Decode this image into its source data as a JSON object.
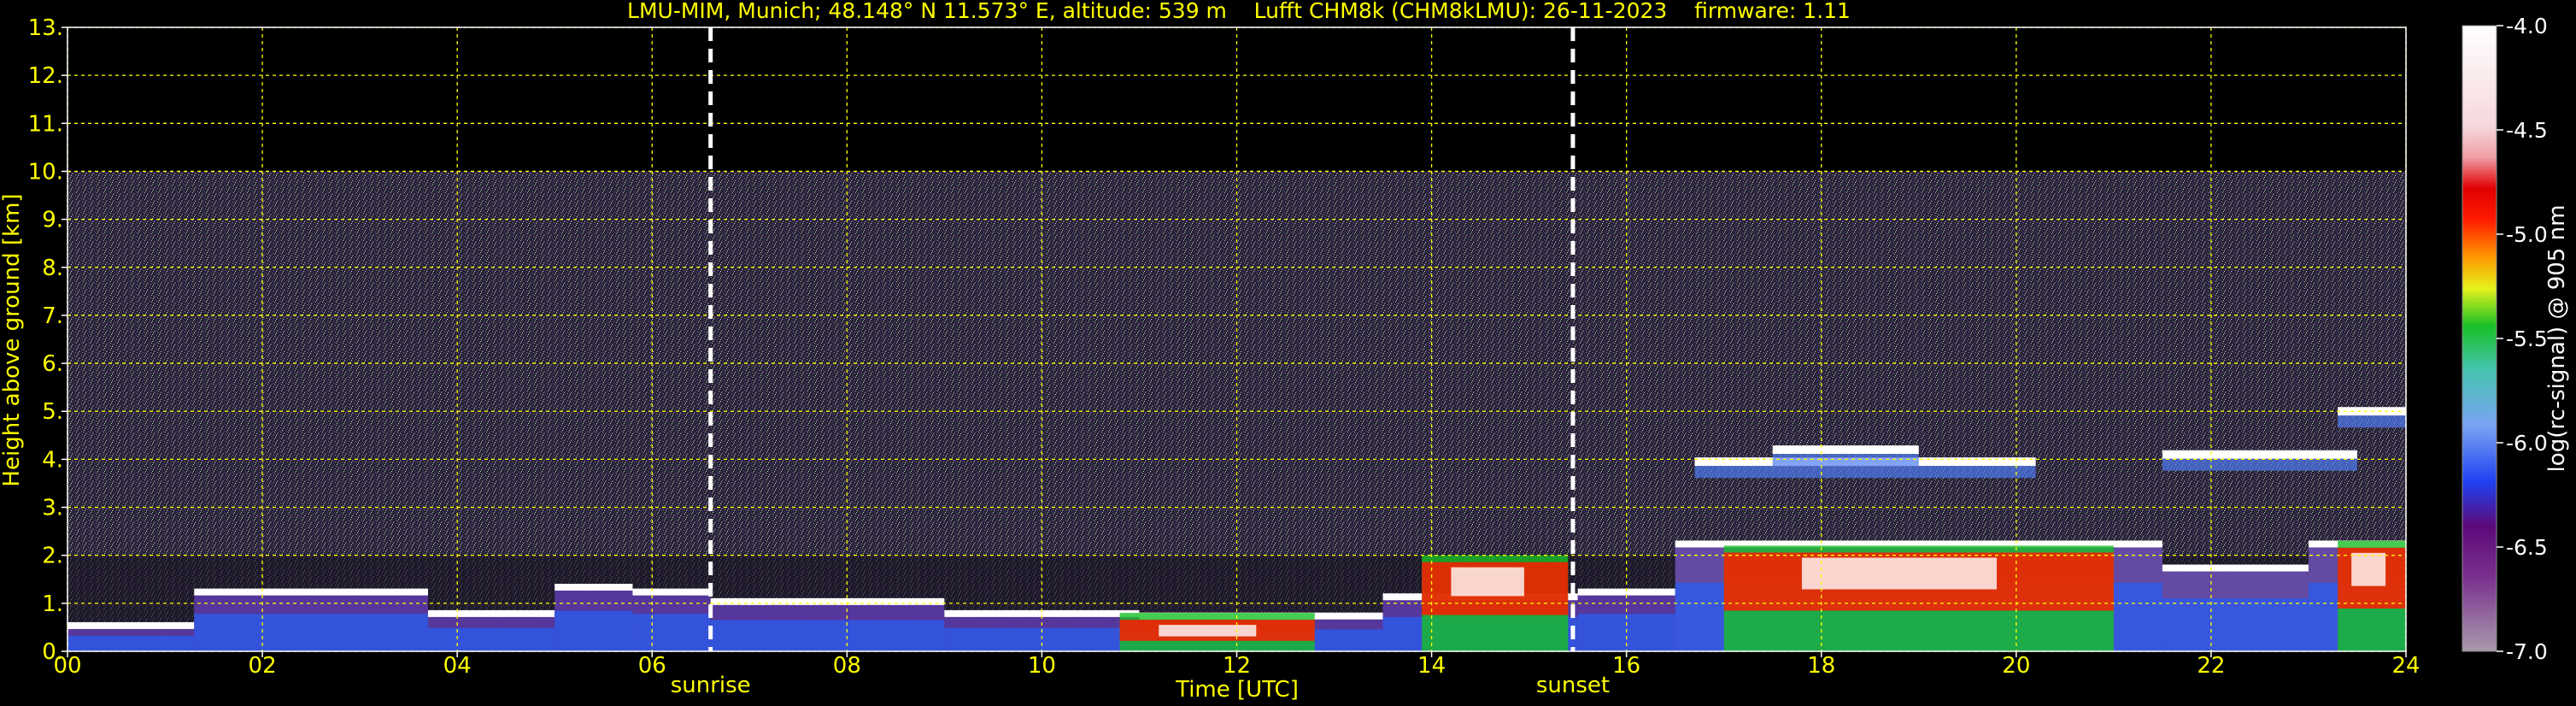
{
  "chart_data": {
    "type": "heatmap",
    "title": "LMU-MIM, Munich; 48.148° N 11.573° E, altitude: 539 m    Lufft CHM8k (CHM8kLMU): 26-11-2023    firmware: 1.11",
    "xlabel": "Time [UTC]",
    "ylabel": "Height above ground [km]",
    "xlim": [
      0,
      24
    ],
    "ylim": [
      0,
      13
    ],
    "x_ticks": [
      "00",
      "02",
      "04",
      "06",
      "08",
      "10",
      "12",
      "14",
      "16",
      "18",
      "20",
      "22",
      "24"
    ],
    "y_ticks": [
      "0.",
      "1.",
      "2.",
      "3.",
      "4.",
      "5.",
      "6.",
      "7.",
      "8.",
      "9.",
      "10.",
      "11.",
      "12.",
      "13."
    ],
    "grid": true,
    "grid_color": "#ffff00",
    "signal_top_km": 10,
    "colorbar": {
      "label": "log(rc-signal) @ 905 nm",
      "ticks": [
        "-4.0",
        "-4.5",
        "-5.0",
        "-5.5",
        "-6.0",
        "-6.5",
        "-7.0"
      ],
      "range": [
        -7.0,
        -4.0
      ],
      "colors": [
        "#a89aac",
        "#9a7fa6",
        "#8a5d9a",
        "#7a2f8e",
        "#5c0a7a",
        "#3a2ac8",
        "#1f40f0",
        "#4f7cf2",
        "#7aa3f4",
        "#9cc0f6",
        "#45c4b0",
        "#1ea46a",
        "#18c026",
        "#7ee61a",
        "#e6f21c",
        "#ffd400",
        "#ff9800",
        "#ff5a00",
        "#ff1a00",
        "#e00000",
        "#f0a0a8",
        "#f6d8dc",
        "#ffffff"
      ]
    },
    "markers": [
      {
        "label": "sunrise",
        "x": 6.6
      },
      {
        "label": "sunset",
        "x": 15.45
      }
    ],
    "cloud_base_layers": [
      {
        "start": 0.0,
        "end": 1.3,
        "height": 0.5
      },
      {
        "start": 1.3,
        "end": 3.7,
        "height": 1.2
      },
      {
        "start": 3.7,
        "end": 5.0,
        "height": 0.75
      },
      {
        "start": 5.0,
        "end": 5.8,
        "height": 1.3
      },
      {
        "start": 5.8,
        "end": 6.6,
        "height": 1.2
      },
      {
        "start": 6.6,
        "end": 9.0,
        "height": 1.0
      },
      {
        "start": 9.0,
        "end": 11.0,
        "height": 0.75
      },
      {
        "start": 11.0,
        "end": 13.5,
        "height": 0.7
      },
      {
        "start": 13.5,
        "end": 15.5,
        "height": 1.1
      },
      {
        "start": 15.5,
        "end": 16.5,
        "height": 1.2
      },
      {
        "start": 16.5,
        "end": 21.5,
        "height": 2.2
      },
      {
        "start": 21.5,
        "end": 23.0,
        "height": 1.7
      },
      {
        "start": 23.0,
        "end": 24.0,
        "height": 2.2
      }
    ],
    "upper_layers": [
      {
        "start": 16.7,
        "end": 20.2,
        "height": 3.95
      },
      {
        "start": 17.5,
        "end": 19.0,
        "height": 4.2
      },
      {
        "start": 21.5,
        "end": 23.5,
        "height": 4.1
      },
      {
        "start": 23.3,
        "end": 24.0,
        "height": 5.0
      }
    ],
    "high_intensity_regions": [
      {
        "start": 10.8,
        "end": 12.8,
        "top": 0.8
      },
      {
        "start": 13.9,
        "end": 15.4,
        "top": 2.0
      },
      {
        "start": 17.0,
        "end": 21.0,
        "top": 2.2
      },
      {
        "start": 23.3,
        "end": 24.0,
        "top": 2.3
      }
    ]
  }
}
